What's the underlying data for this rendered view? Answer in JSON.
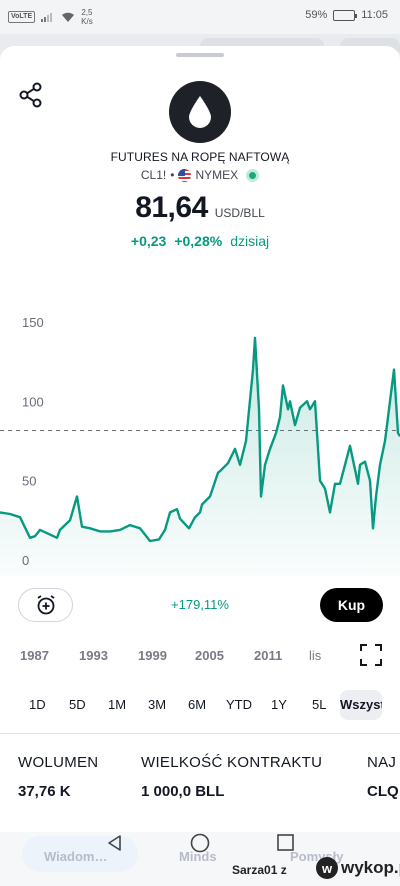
{
  "status_bar": {
    "volte": "VoLTE",
    "net_speed_value": "2,5",
    "net_speed_unit": "K/s",
    "battery": "59%",
    "battery_level": 0.59,
    "time": "11:05"
  },
  "instrument": {
    "name": "FUTURES NA ROPĘ NAFTOWĄ",
    "ticker": "CL1!",
    "separator": "•",
    "exchange": "NYMEX",
    "price": "81,64",
    "currency": "USD/BLL",
    "change_abs": "+0,23",
    "change_pct": "+0,28%",
    "change_period": "dzisiaj"
  },
  "chart_data": {
    "type": "area",
    "x_start": 1983,
    "x_end": 2023,
    "ylim": [
      0,
      165
    ],
    "y_ticks": [
      "150",
      "100",
      "50",
      "0"
    ],
    "y_tick_values": [
      150,
      100,
      50,
      0
    ],
    "current_price_line": 81.64,
    "line_color": "#089981",
    "x": [
      1983,
      1984,
      1985,
      1986,
      1986.5,
      1987,
      1988,
      1988.7,
      1989,
      1990,
      1990.7,
      1991.2,
      1992,
      1993,
      1994,
      1995,
      1996,
      1997,
      1998,
      1998.9,
      1999.5,
      2000,
      2000.7,
      2001,
      2001.9,
      2002.5,
      2003,
      2003.2,
      2004,
      2004.8,
      2005,
      2005.8,
      2006.5,
      2007,
      2007.6,
      2008.3,
      2008.5,
      2008.9,
      2009.1,
      2009.5,
      2010,
      2010.6,
      2011,
      2011.3,
      2011.8,
      2012,
      2012.5,
      2013,
      2013.7,
      2014,
      2014.5,
      2015,
      2015.5,
      2016,
      2016.5,
      2017,
      2017.5,
      2018,
      2018.8,
      2019,
      2019.5,
      2020,
      2020.3,
      2020.6,
      2021,
      2021.5,
      2022,
      2022.4,
      2022.8,
      2023
    ],
    "values": [
      30,
      29,
      27,
      14,
      15,
      19,
      16,
      14,
      19,
      25,
      40,
      21,
      20,
      18,
      18,
      19,
      22,
      20,
      12,
      13,
      19,
      30,
      32,
      26,
      20,
      27,
      30,
      35,
      40,
      55,
      56,
      61,
      70,
      60,
      75,
      120,
      140,
      95,
      40,
      60,
      70,
      80,
      90,
      110,
      95,
      100,
      85,
      96,
      100,
      95,
      100,
      50,
      45,
      30,
      48,
      48,
      60,
      72,
      48,
      60,
      62,
      50,
      20,
      40,
      60,
      75,
      100,
      120,
      80,
      78
    ]
  },
  "actions": {
    "alert_icon": "alarm-add-icon",
    "performance": "+179,11%",
    "buy_label": "Kup"
  },
  "year_labels": [
    "1987",
    "1993",
    "1999",
    "2005",
    "2011",
    "lis"
  ],
  "ranges": [
    "1D",
    "5D",
    "1M",
    "3M",
    "6M",
    "YTD",
    "1Y",
    "5L"
  ],
  "active_range": "Wszystko",
  "stats": [
    {
      "label": "WOLUMEN",
      "value": "37,76 K"
    },
    {
      "label": "WIELKOŚĆ KONTRAKTU",
      "value": "1 000,0 BLL"
    },
    {
      "label": "NAJ",
      "value": "CLQ"
    }
  ],
  "bottom_tabs": [
    "Wiadom…",
    "Minds",
    "Pomysły"
  ],
  "watermark": {
    "user_text": "Sarza01 z",
    "site": "wykop.pl",
    "site_icon_letter": "w"
  }
}
